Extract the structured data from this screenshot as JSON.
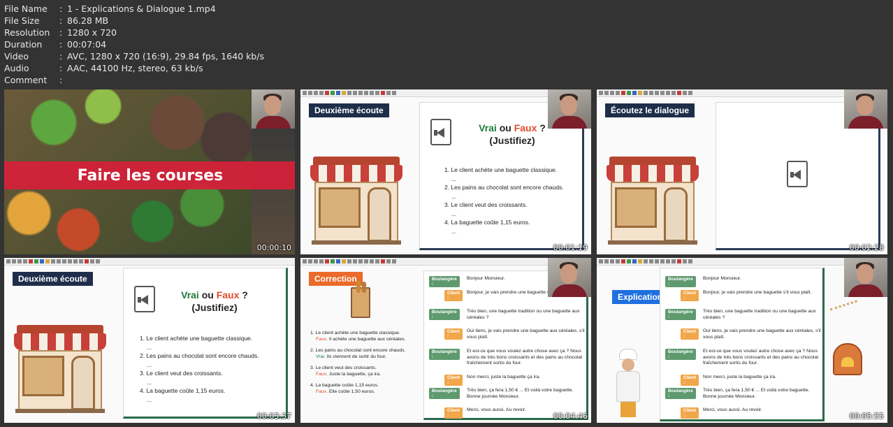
{
  "meta": [
    {
      "key": "File Name",
      "value": "1 - Explications & Dialogue 1.mp4"
    },
    {
      "key": "File Size",
      "value": "86.28 MB"
    },
    {
      "key": "Resolution",
      "value": "1280 x 720"
    },
    {
      "key": "Duration",
      "value": "00:07:04"
    },
    {
      "key": "Video",
      "value": "AVC, 1280 x 720 (16:9), 29.84 fps, 1640 kb/s"
    },
    {
      "key": "Audio",
      "value": "AAC, 44100 Hz, stereo, 63 kb/s"
    },
    {
      "key": "Comment",
      "value": ""
    }
  ],
  "meta_sep": ":",
  "thumbs": [
    {
      "timestamp": "00:00:10",
      "banner": "Faire les courses"
    },
    {
      "timestamp": "00:01:19",
      "tag": "Deuxième écoute",
      "icon": "speaker-doc-icon"
    },
    {
      "timestamp": "00:02:28",
      "tag": "Écoutez le dialogue",
      "icon": "speaker-doc-icon"
    },
    {
      "timestamp": "00:03:37",
      "tag": "Deuxième écoute",
      "icon": "speaker-doc-icon"
    },
    {
      "timestamp": "00:04:46",
      "tag": "Correction"
    },
    {
      "timestamp": "00:05:55",
      "tag": "Explications"
    }
  ],
  "vf": {
    "vrai": "Vrai",
    "ou": "ou",
    "faux": "Faux",
    "q": "?",
    "justifiez": "(Justifiez)"
  },
  "questions": [
    "1. Le client achète une baguette classique.",
    "2. Les pains au chocolat sont encore chauds.",
    "3. Le client veut des croissants.",
    "4. La baguette coûte 1,15 euros."
  ],
  "dots": "...",
  "corrections": [
    {
      "q": "1. Le client achète une baguette classique.",
      "verdict": "Faux.",
      "detail": "Il achète une baguette aux céréales."
    },
    {
      "q": "2. Les pains au chocolat sont encore chauds.",
      "verdict": "Vrai.",
      "detail": "Ils viennent de sortir du four."
    },
    {
      "q": "3. Le client veut des croissants.",
      "verdict": "Faux.",
      "detail": "Juste la baguette, ça ira."
    },
    {
      "q": "4. La baguette coûte 1,15 euros.",
      "verdict": "Faux.",
      "detail": "Elle coûte 1,50 euros."
    }
  ],
  "speakers": {
    "b": "Boulangère :",
    "c": "Client :"
  },
  "dialogue": [
    {
      "s": "b",
      "t": "Bonjour Monsieur."
    },
    {
      "s": "c",
      "t": "Bonjour, je vais prendre une baguette s'il vous plaît."
    },
    {
      "s": "b",
      "t": "Très bien, une baguette tradition ou une baguette aux céréales ?"
    },
    {
      "s": "c",
      "t": "Oui tiens, je vais prendre une baguette aux céréales, s'il vous plaît."
    },
    {
      "s": "b",
      "t": "Et est-ce que vous voulez autre chose avec ça ? Nous avons de très bons croissants et des pains au chocolat fraîchement sortis du four."
    },
    {
      "s": "c",
      "t": "Non merci, juste la baguette ça ira."
    },
    {
      "s": "b",
      "t": "Très bien, ça fera 1,50 € ... Et voilà votre baguette. Bonne journée Monsieur."
    },
    {
      "s": "c",
      "t": "Merci, vous aussi. Au revoir."
    }
  ]
}
